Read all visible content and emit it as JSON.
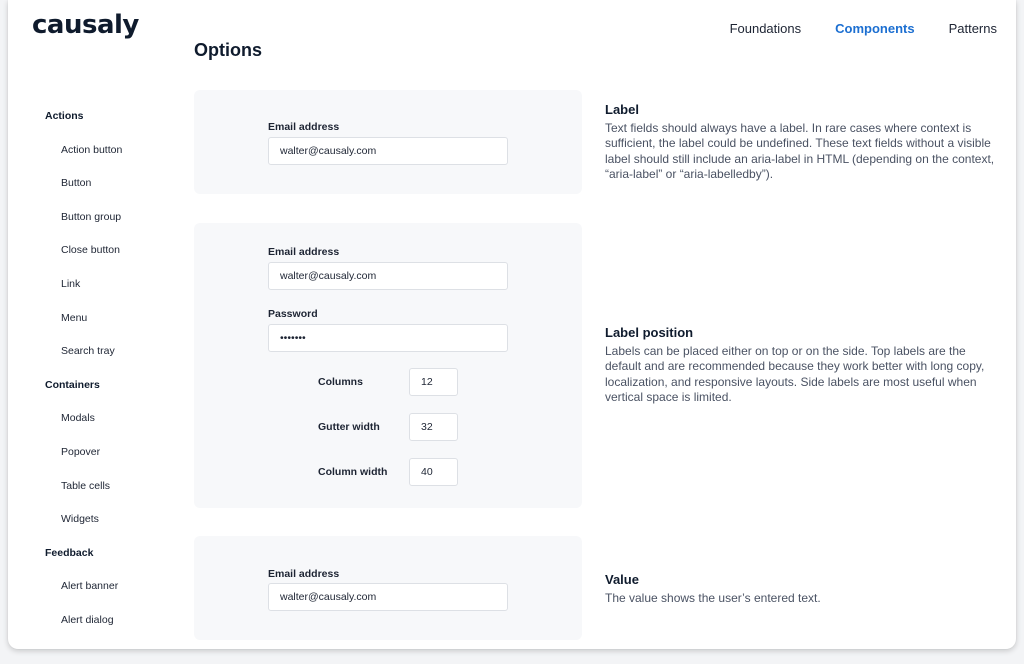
{
  "brand": {
    "logo": "causaly"
  },
  "topnav": [
    {
      "label": "Foundations",
      "active": false
    },
    {
      "label": "Components",
      "active": true
    },
    {
      "label": "Patterns",
      "active": false
    }
  ],
  "colors": {
    "accent": "#1c6fd1",
    "text": "#1d2433",
    "muted": "#4a5263",
    "panel": "#f7f8fa"
  },
  "page": {
    "title": "Options"
  },
  "sidebar": {
    "groups": [
      {
        "label": "Actions",
        "items": [
          "Action button",
          "Button",
          "Button group",
          "Close button",
          "Link",
          "Menu",
          "Search tray"
        ]
      },
      {
        "label": "Containers",
        "items": [
          "Modals",
          "Popover",
          "Table cells",
          "Widgets"
        ]
      },
      {
        "label": "Feedback",
        "items": [
          "Alert banner",
          "Alert dialog"
        ]
      }
    ]
  },
  "sections": {
    "label": {
      "title": "Label",
      "body": "Text fields should always have a label. In rare cases where context is sufficient, the label could be undefined. These text fields without a visible label should still include an aria-label in HTML (depending on the context, “aria-label” or “aria-labelledby”).",
      "example": {
        "email_label": "Email address",
        "email_value": "walter@causaly.com"
      }
    },
    "label_position": {
      "title": "Label position",
      "body": "Labels can be placed either on top or on the side. Top labels are the default and are recommended because they work better with long copy, localization, and responsive layouts. Side labels are most useful when vertical space is limited.",
      "example": {
        "email_label": "Email address",
        "email_value": "walter@causaly.com",
        "password_label": "Password",
        "password_value": "•••••••",
        "columns_label": "Columns",
        "columns_value": "12",
        "gutter_label": "Gutter width",
        "gutter_value": "32",
        "column_width_label": "Column width",
        "column_width_value": "40"
      }
    },
    "value": {
      "title": "Value",
      "body": "The value shows the user’s entered text.",
      "example": {
        "email_label": "Email address",
        "email_value": "walter@causaly.com"
      }
    }
  }
}
